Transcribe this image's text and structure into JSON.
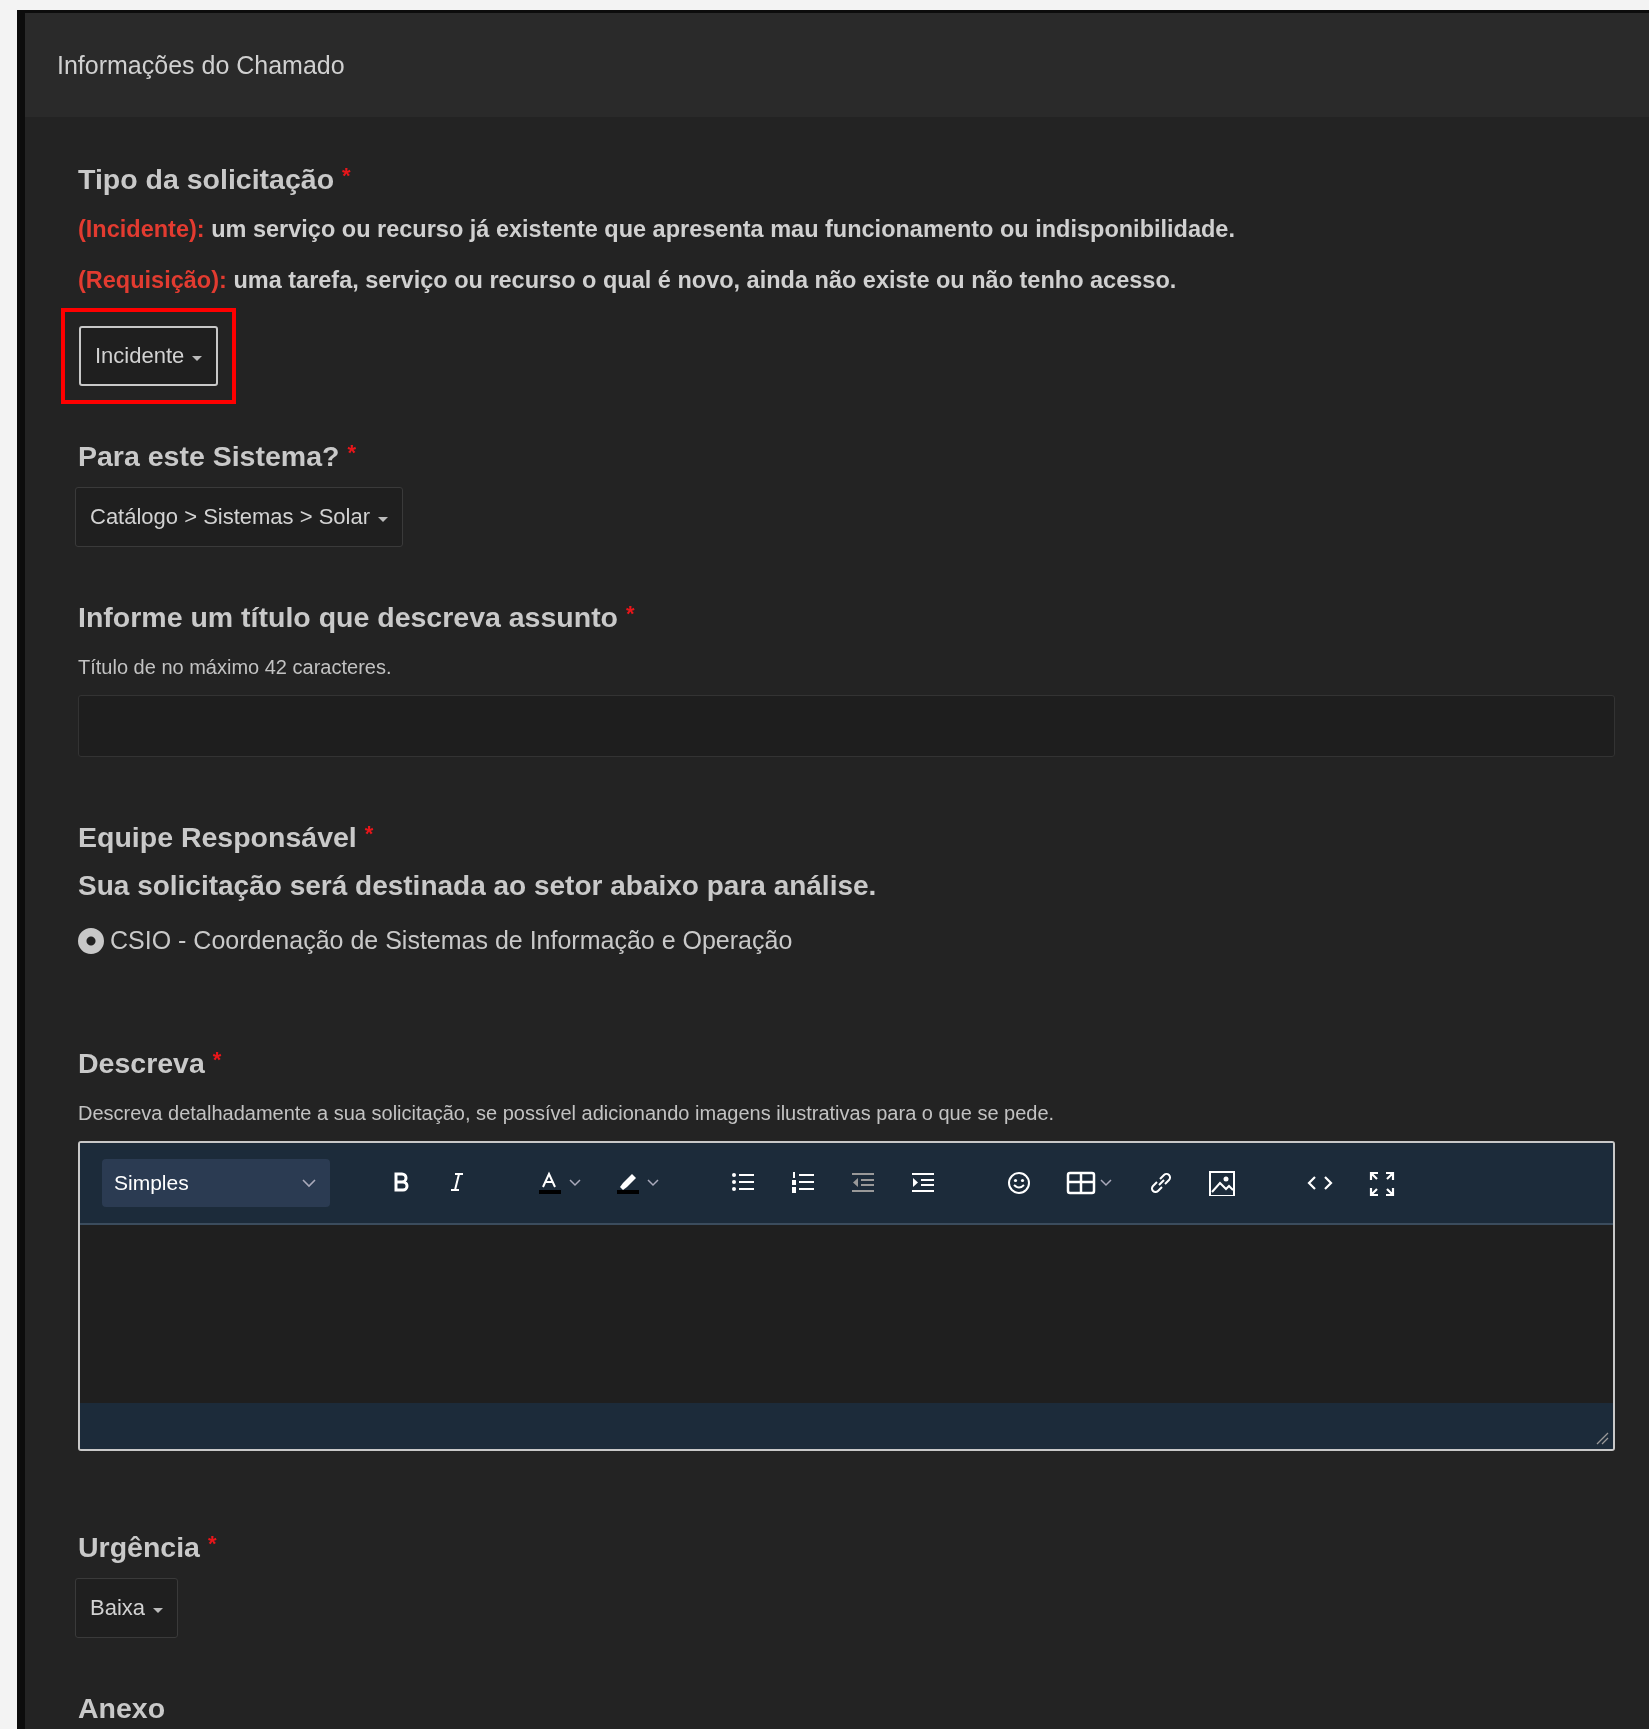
{
  "panel": {
    "title": "Informações do Chamado"
  },
  "fields": [
    {
      "kind": "select",
      "label": "Tipo da solicitação",
      "required_mark": "*",
      "definitions": [
        {
          "term": "(Incidente):",
          "text": "um serviço ou recurso já existente que apresenta mau funcionamento ou indisponibilidade."
        },
        {
          "term": "(Requisição):",
          "text": "uma tarefa, serviço ou recurso o qual é novo, ainda não existe ou não tenho acesso."
        }
      ],
      "value": "Incidente",
      "highlighted": true
    },
    {
      "kind": "select",
      "label": "Para este Sistema?",
      "required_mark": "*",
      "value": "Catálogo > Sistemas > Solar",
      "highlighted": false
    },
    {
      "kind": "text",
      "label": "Informe um título que descreva assunto",
      "required_mark": "*",
      "hint": "Título de no máximo 42 caracteres."
    },
    {
      "kind": "radio",
      "label": "Equipe Responsável",
      "required_mark": "*",
      "subtitle": "Sua solicitação será destinada ao setor abaixo para análise.",
      "options": [
        {
          "label": "CSIO - Coordenação de Sistemas de Informação e Operação",
          "selected": true
        }
      ]
    },
    {
      "kind": "editor",
      "label": "Descreva",
      "required_mark": "*",
      "hint": "Descreva detalhadamente a sua solicitação, se possível adicionando imagens ilustrativas para o que se pede.",
      "format": "Simples"
    },
    {
      "kind": "select",
      "label": "Urgência",
      "required_mark": "*",
      "value": "Baixa",
      "highlighted": false
    },
    {
      "kind": "file",
      "label": "Anexo"
    }
  ]
}
